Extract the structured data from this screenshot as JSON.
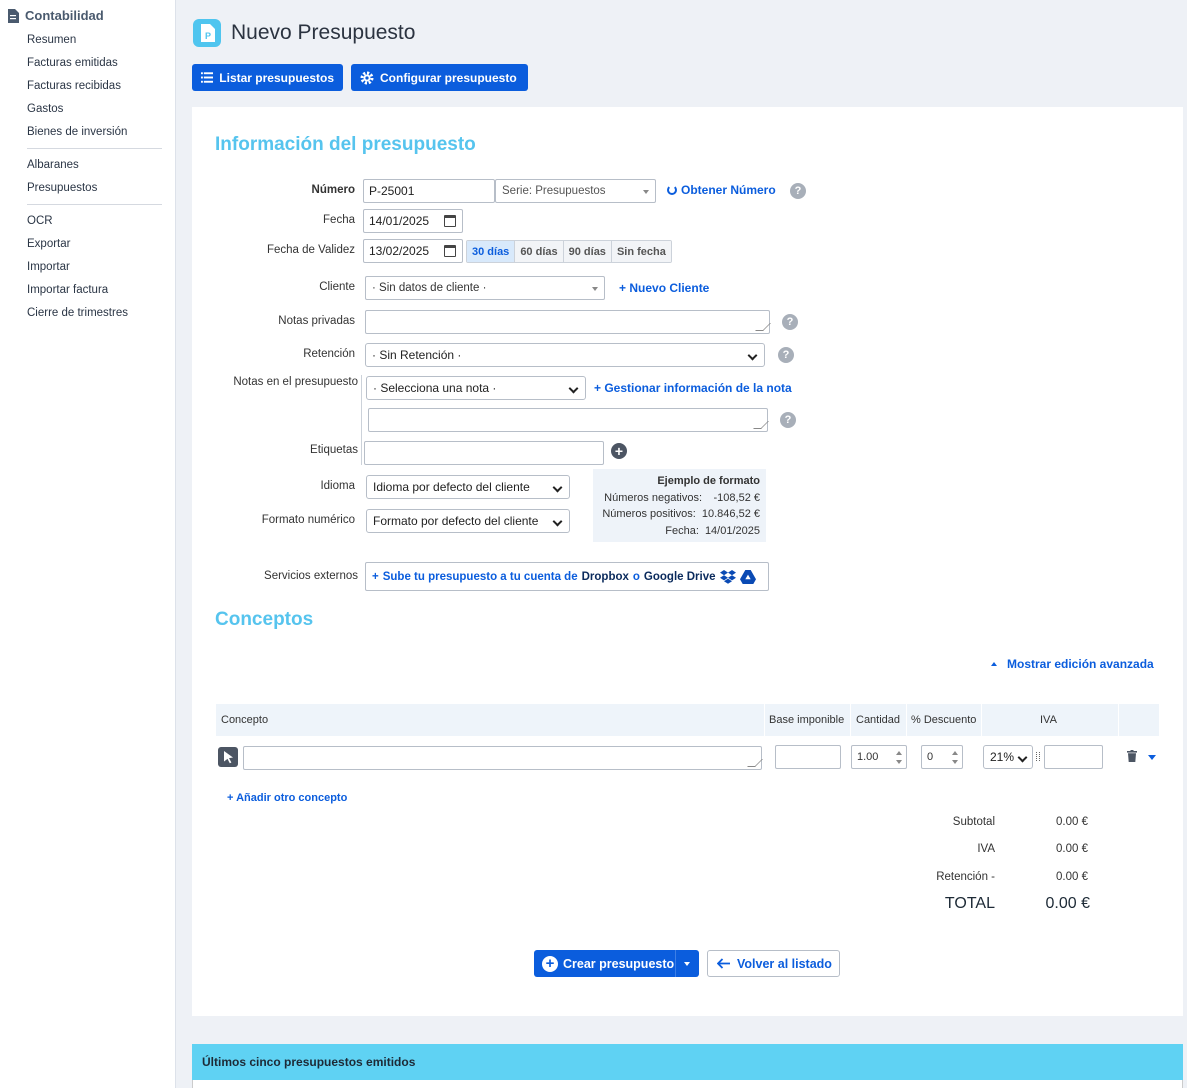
{
  "sidebar": {
    "section_title": "Contabilidad",
    "items": [
      "Resumen",
      "Facturas emitidas",
      "Facturas recibidas",
      "Gastos",
      "Bienes de inversión",
      "Albaranes",
      "Presupuestos",
      "OCR",
      "Exportar",
      "Importar",
      "Importar factura",
      "Cierre de trimestres"
    ]
  },
  "page": {
    "title": "Nuevo Presupuesto"
  },
  "toolbar": {
    "list_label": "Listar presupuestos",
    "config_label": "Configurar presupuesto"
  },
  "info": {
    "section_title": "Información del presupuesto",
    "numero_label": "Número",
    "numero_value": "P-25001",
    "serie_value": "Serie: Presupuestos",
    "obtener_numero": "Obtener Número",
    "fecha_label": "Fecha",
    "fecha_value": "14/01/2025",
    "validez_label": "Fecha de Validez",
    "validez_value": "13/02/2025",
    "validez_options": [
      "30 días",
      "60 días",
      "90 días",
      "Sin fecha"
    ],
    "validez_selected": "30 días",
    "cliente_label": "Cliente",
    "cliente_value": "· Sin datos de cliente ·",
    "nuevo_cliente": "Nuevo Cliente",
    "notas_privadas_label": "Notas privadas",
    "retencion_label": "Retención",
    "retencion_value": "· Sin Retención ·",
    "notas_presupuesto_label": "Notas en el presupuesto",
    "nota_select_value": "· Selecciona una nota ·",
    "gestionar_nota": "Gestionar información de la nota",
    "etiquetas_label": "Etiquetas",
    "idioma_label": "Idioma",
    "idioma_value": "Idioma por defecto del cliente",
    "formato_label": "Formato numérico",
    "formato_value": "Formato por defecto del cliente",
    "formato_ejemplo": {
      "title": "Ejemplo de formato",
      "neg_label": "Números negativos:",
      "neg_value": "-108,52 €",
      "pos_label": "Números positivos:",
      "pos_value": "10.846,52 €",
      "fecha_label": "Fecha:",
      "fecha_value": "14/01/2025"
    },
    "servicios_label": "Servicios externos",
    "servicios_prefix": "Sube tu presupuesto a tu cuenta de",
    "servicios_dropbox": "Dropbox",
    "servicios_o": "o",
    "servicios_gdrive": "Google Drive"
  },
  "conceptos": {
    "section_title": "Conceptos",
    "advanced_toggle": "Mostrar edición avanzada",
    "columns": [
      "Concepto",
      "Base imponible",
      "Cantidad",
      "% Descuento",
      "IVA"
    ],
    "row": {
      "cantidad": "1.00",
      "descuento": "0",
      "iva": "21%"
    },
    "add_concept": "Añadir otro concepto"
  },
  "totals": {
    "subtotal_label": "Subtotal",
    "subtotal_value": "0.00 €",
    "iva_label": "IVA",
    "iva_value": "0.00 €",
    "retencion_label": "Retención -",
    "retencion_value": "0.00 €",
    "total_label": "TOTAL",
    "total_value": "0.00 €"
  },
  "actions": {
    "create": "Crear presupuesto",
    "back": "Volver al listado"
  },
  "footer": {
    "title": "Últimos cinco presupuestos emitidos"
  },
  "colors": {
    "primary": "#0b5ddd",
    "accent": "#56c4ee",
    "footer_bg": "#5fd2f3"
  }
}
